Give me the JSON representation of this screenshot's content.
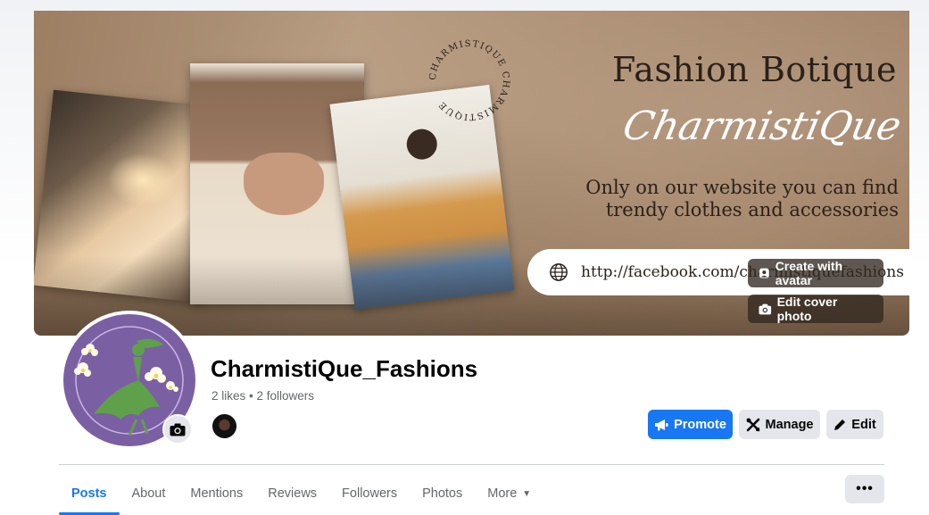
{
  "cover": {
    "circle_text": "CHARMISTIQUE CHARMISTIQUE",
    "title": "Fashion Botique",
    "script": "CharmistiQue",
    "tagline_line1": "Only on our website you can find",
    "tagline_line2": "trendy clothes and accessories",
    "url": "http://facebook.com/charmistiquefashions",
    "create_avatar_label": "Create with avatar",
    "edit_cover_label": "Edit cover photo"
  },
  "profile": {
    "name": "CharmistiQue_Fashions",
    "stats": "2 likes • 2 followers"
  },
  "actions": {
    "promote": "Promote",
    "manage": "Manage",
    "edit": "Edit"
  },
  "tabs": [
    {
      "label": "Posts",
      "active": true
    },
    {
      "label": "About"
    },
    {
      "label": "Mentions"
    },
    {
      "label": "Reviews"
    },
    {
      "label": "Followers"
    },
    {
      "label": "Photos"
    },
    {
      "label": "More"
    }
  ],
  "more_menu_label": "•••",
  "colors": {
    "accent": "#1877f2",
    "button_gray": "#e4e6eb",
    "avatar_purple": "#7b5fa3"
  },
  "icons": [
    "globe-icon",
    "avatar-icon",
    "camera-icon",
    "megaphone-icon",
    "tools-icon",
    "pencil-icon",
    "caret-down-icon",
    "more-dots-icon"
  ]
}
